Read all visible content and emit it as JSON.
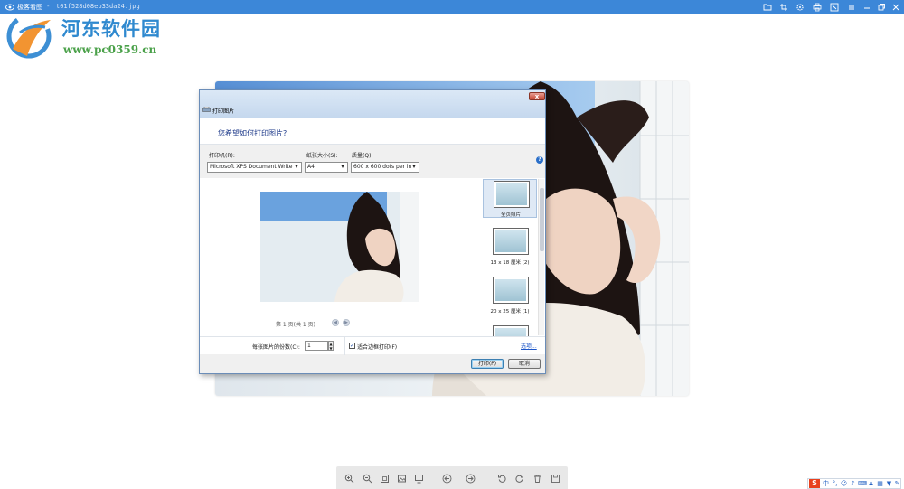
{
  "titlebar": {
    "app_name": "极客看图",
    "separator": "-",
    "file_name": "t01f528d08eb33da24.jpg",
    "buttons": [
      "open-folder-icon",
      "crop-icon",
      "settings-icon",
      "print-icon",
      "fullscreen-icon",
      "menu-icon",
      "minimize-icon",
      "restore-icon",
      "close-icon"
    ]
  },
  "watermark": {
    "title": "河东软件园",
    "url": "www.pc0359.cn"
  },
  "dialog": {
    "title": "打印图片",
    "close_label": "x",
    "heading": "您希望如何打印图片?",
    "printer_label": "打印机(R):",
    "printer_value": "Microsoft XPS Document Write",
    "paper_label": "纸张大小(S):",
    "paper_value": "A4",
    "quality_label": "质量(Q):",
    "quality_value": "600 x 600 dots per in",
    "help_label": "?",
    "page_info": "第 1 页(共 1 页)",
    "layouts": [
      {
        "label": "全页照片",
        "selected": true
      },
      {
        "label": "13 x 18 厘米 (2)",
        "selected": false
      },
      {
        "label": "20 x 25 厘米 (1)",
        "selected": false
      }
    ],
    "copies_label": "每张图片的份数(C):",
    "copies_value": "1",
    "fit_label": "适合边框打印(F)",
    "fit_checked": true,
    "options_link": "选项...",
    "print_button": "打印(P)",
    "cancel_button": "取消"
  },
  "ime": {
    "logo": "S",
    "mode": "中"
  }
}
